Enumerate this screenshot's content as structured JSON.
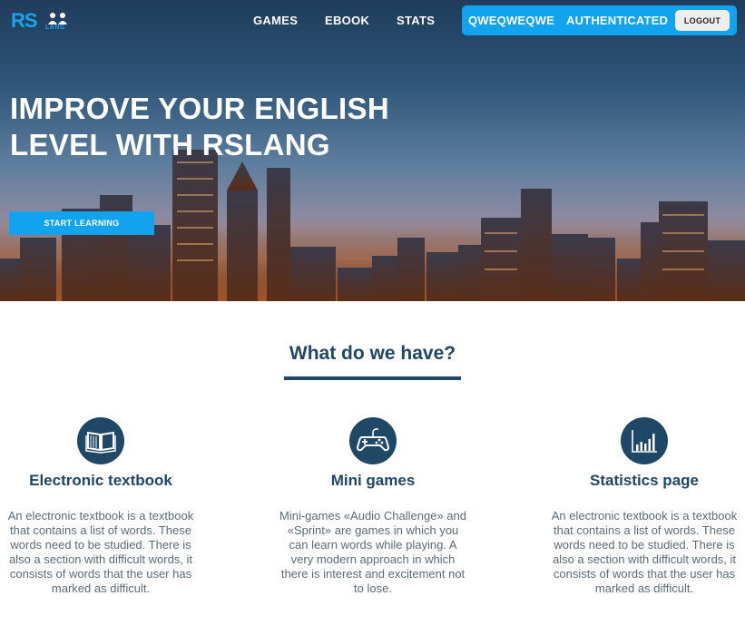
{
  "brand": {
    "logo_text": "RS",
    "logo_sub": "LANG"
  },
  "nav": {
    "items": [
      {
        "label": "GAMES"
      },
      {
        "label": "EBOOK"
      },
      {
        "label": "STATS"
      }
    ]
  },
  "user": {
    "name": "QWEQWEQWE",
    "status": "AUTHENTICATED",
    "logout_label": "LOGOUT"
  },
  "hero": {
    "title": "IMPROVE YOUR ENGLISH LEVEL WITH RSLANG",
    "cta_label": "START LEARNING"
  },
  "features": {
    "title": "What do we have?",
    "items": [
      {
        "icon": "book-icon",
        "title": "Electronic textbook",
        "text": "An electronic textbook is a textbook that contains a list of words. These words need to be studied. There is also a section with difficult words, it consists of words that the user has marked as difficult."
      },
      {
        "icon": "gamepad-icon",
        "title": "Mini games",
        "text": "Mini-games «Audio Challenge» and «Sprint» are games in which you can learn words while playing. A very modern approach in which there is interest and excitement not to lose."
      },
      {
        "icon": "bar-chart-icon",
        "title": "Statistics page",
        "text": "An electronic textbook is a textbook that contains a list of words. These words need to be studied. There is also a section with difficult words, it consists of words that the user has marked as difficult."
      }
    ]
  },
  "colors": {
    "accent": "#12a3ef",
    "primary_dark": "#1f4766",
    "body_text": "#5b6b78"
  }
}
